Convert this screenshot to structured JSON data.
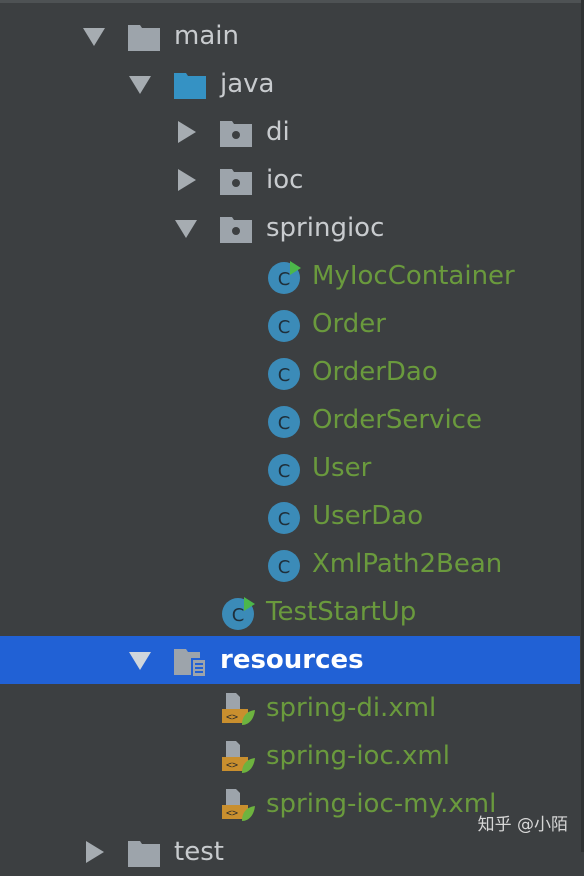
{
  "tree": {
    "main": {
      "label": "main",
      "icon": "folder-icon",
      "expanded": true
    },
    "java": {
      "label": "java",
      "icon": "source-folder-icon",
      "expanded": true
    },
    "di": {
      "label": "di",
      "icon": "package-icon",
      "expanded": false
    },
    "ioc": {
      "label": "ioc",
      "icon": "package-icon",
      "expanded": false
    },
    "springioc": {
      "label": "springioc",
      "icon": "package-icon",
      "expanded": true
    },
    "classes": [
      {
        "label": "MyIocContainer",
        "icon": "runnable-class-icon"
      },
      {
        "label": "Order",
        "icon": "class-icon"
      },
      {
        "label": "OrderDao",
        "icon": "class-icon"
      },
      {
        "label": "OrderService",
        "icon": "class-icon"
      },
      {
        "label": "User",
        "icon": "class-icon"
      },
      {
        "label": "UserDao",
        "icon": "class-icon"
      },
      {
        "label": "XmlPath2Bean",
        "icon": "class-icon"
      }
    ],
    "teststartup": {
      "label": "TestStartUp",
      "icon": "runnable-class-icon"
    },
    "resources": {
      "label": "resources",
      "icon": "resources-folder-icon",
      "expanded": true,
      "selected": true
    },
    "xml_files": [
      {
        "label": "spring-di.xml",
        "icon": "spring-xml-icon"
      },
      {
        "label": "spring-ioc.xml",
        "icon": "spring-xml-icon"
      },
      {
        "label": "spring-ioc-my.xml",
        "icon": "spring-xml-icon"
      }
    ],
    "test": {
      "label": "test",
      "icon": "folder-icon",
      "expanded": false
    }
  },
  "watermark": "知乎 @小陌",
  "colors": {
    "background": "#3c3f41",
    "selection": "#2161d5",
    "folder_text": "#c8cbce",
    "file_text": "#6a9a3d",
    "class_icon": "#3b8bb8",
    "folder_icon": "#9da4ab",
    "source_folder_icon": "#3592c4"
  }
}
